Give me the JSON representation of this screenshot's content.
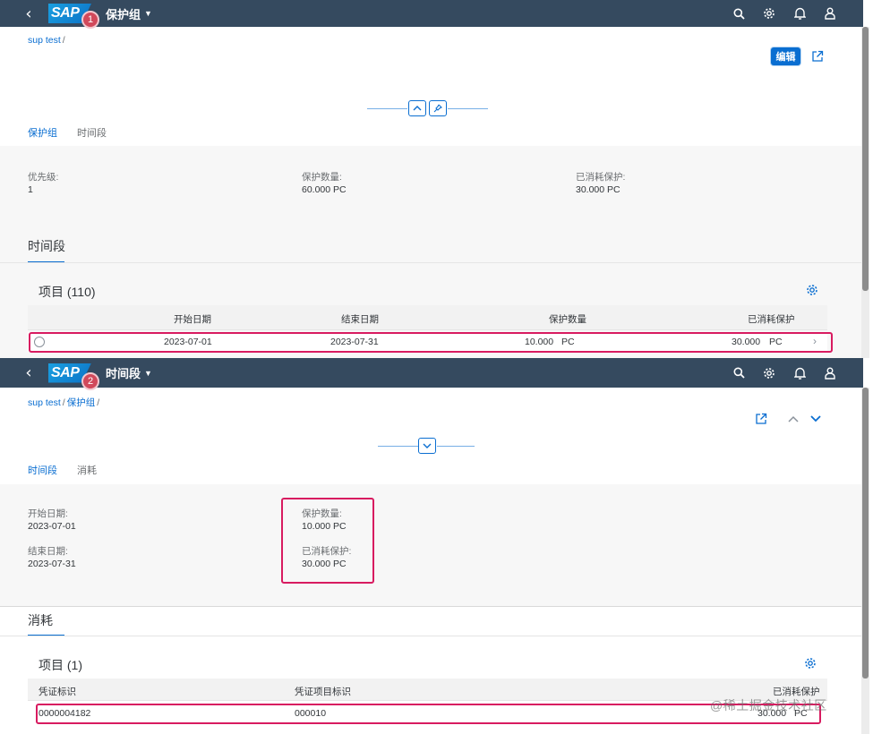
{
  "screen1": {
    "app_title": "保护组",
    "logo_text": "SAP",
    "badge": "1",
    "breadcrumb": [
      "sup test"
    ],
    "edit_label": "编辑",
    "tabs": [
      {
        "label": "保护组",
        "active": true
      },
      {
        "label": "时间段",
        "active": false
      }
    ],
    "fields": [
      {
        "label": "优先级:",
        "value": "1"
      },
      {
        "label": "保护数量:",
        "value": "60.000 PC"
      },
      {
        "label": "已消耗保护:",
        "value": "30.000 PC"
      }
    ],
    "section_title": "时间段",
    "table": {
      "title": "项目 (110)",
      "columns": [
        "开始日期",
        "结束日期",
        "保护数量",
        "已消耗保护"
      ],
      "rows": [
        {
          "start": "2023-07-01",
          "end": "2023-07-31",
          "qty": "10.000",
          "qty_unit": "PC",
          "consumed": "30.000",
          "consumed_unit": "PC"
        }
      ]
    }
  },
  "screen2": {
    "app_title": "时间段",
    "logo_text": "SAP",
    "badge": "2",
    "breadcrumb": [
      "sup test",
      "保护组"
    ],
    "tabs": [
      {
        "label": "时间段",
        "active": true
      },
      {
        "label": "消耗",
        "active": false
      }
    ],
    "fields": [
      {
        "label": "开始日期:",
        "value": "2023-07-01"
      },
      {
        "label": "结束日期:",
        "value": "2023-07-31"
      },
      {
        "label": "保护数量:",
        "value": "10.000 PC"
      },
      {
        "label": "已消耗保护:",
        "value": "30.000 PC"
      }
    ],
    "section_title": "消耗",
    "table": {
      "title": "项目 (1)",
      "columns": [
        "凭证标识",
        "凭证项目标识",
        "已消耗保护"
      ],
      "rows": [
        {
          "doc_id": "0000004182",
          "item_id": "000010",
          "consumed": "30.000",
          "consumed_unit": "PC"
        }
      ]
    }
  },
  "icons": [
    "back-icon",
    "search-icon",
    "gear-icon",
    "bell-icon",
    "person-icon",
    "share-icon",
    "collapse-icon",
    "pin-icon",
    "expand-icon",
    "arrow-up-icon",
    "arrow-down-icon",
    "chevron-right-icon"
  ],
  "colors": {
    "shell": "#354a5f",
    "accent": "#0a6ed1",
    "highlight": "#d81b60",
    "badge": "#d1495b"
  },
  "watermark": "@稀土掘金技术社区"
}
